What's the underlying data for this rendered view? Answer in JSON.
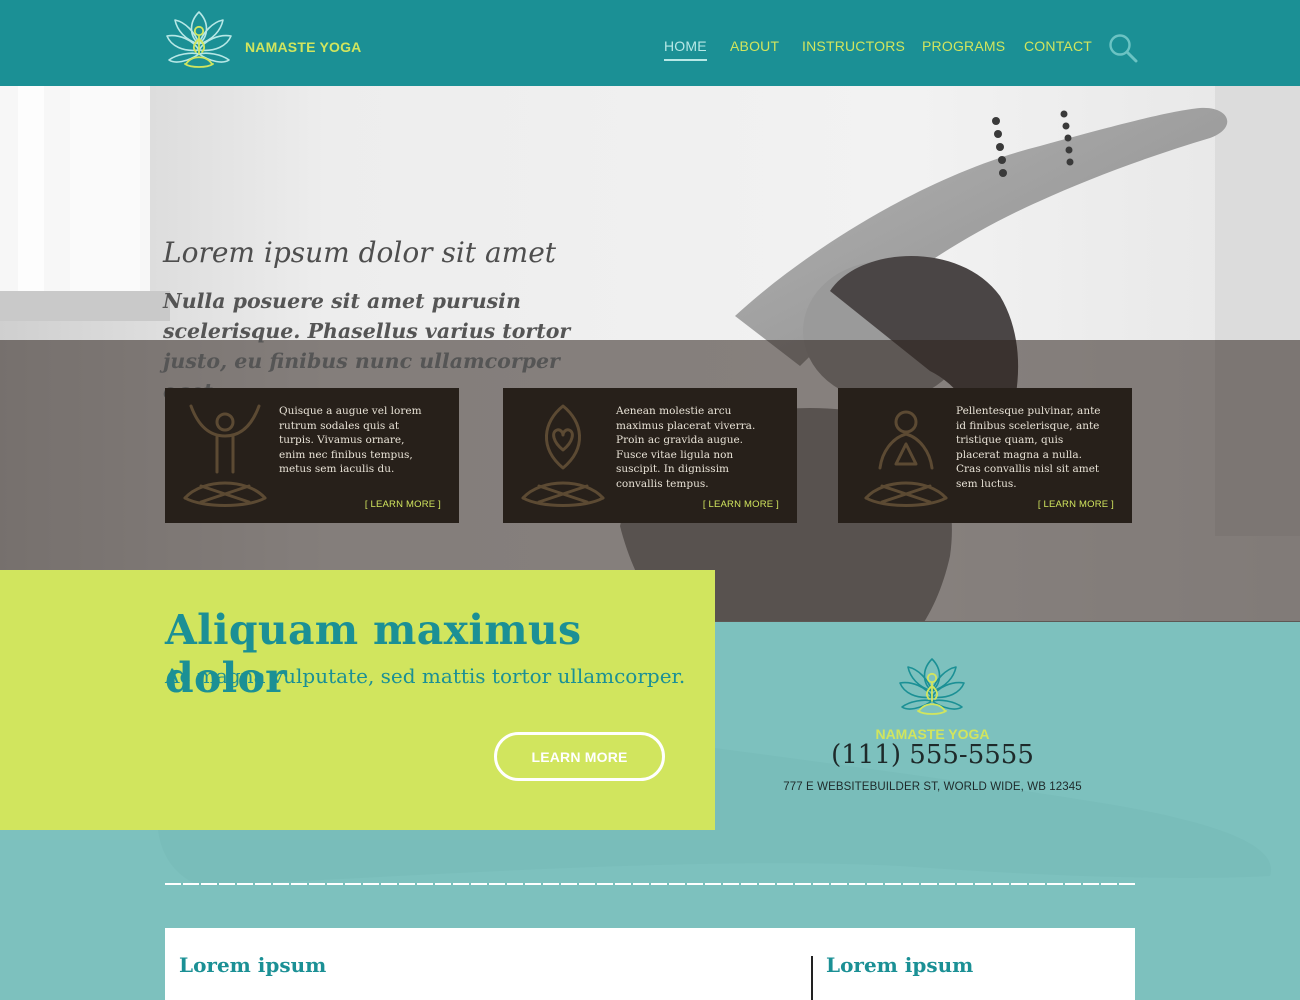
{
  "brand": {
    "name": "NAMASTE YOGA"
  },
  "nav": {
    "items": [
      {
        "label": "HOME",
        "active": true
      },
      {
        "label": "ABOUT",
        "active": false
      },
      {
        "label": "INSTRUCTORS",
        "active": false
      },
      {
        "label": "PROGRAMS",
        "active": false
      },
      {
        "label": "CONTACT",
        "active": false
      }
    ],
    "search_icon": "search-icon"
  },
  "hero": {
    "title": "Lorem ipsum dolor sit amet",
    "subtitle": "Nulla posuere sit amet purusin scelerisque. Phasellus varius tortor justo, eu finibus nunc ullamcorper eget."
  },
  "cards": [
    {
      "icon": "raised-arms-pose-icon",
      "text": "Quisque a augue vel lorem rutrum sodales quis at turpis. Vivamus ornare, enim nec finibus tempus, metus sem iaculis du.",
      "link": "[ LEARN MORE ]"
    },
    {
      "icon": "heart-lotus-pose-icon",
      "text": "Aenean molestie arcu maximus placerat viverra. Proin ac gravida augue. Fusce vitae ligula non suscipit. In dignissim convallis tempus.",
      "link": "[ LEARN MORE ]"
    },
    {
      "icon": "meditation-pose-icon",
      "text": "Pellentesque pulvinar, ante id finibus scelerisque, ante tristique quam, quis placerat magna a nulla. Cras convallis nisl sit amet sem luctus.",
      "link": "[ LEARN MORE ]"
    }
  ],
  "promo": {
    "title": "Aliquam maximus dolor",
    "subtitle": "Ac magna vulputate, sed mattis tortor ullamcorper.",
    "button": "LEARN MORE"
  },
  "contact": {
    "brand": "NAMASTE YOGA",
    "phone": "(111) 555-5555",
    "address": "777 E WEBSITEBUILDER ST, WORLD WIDE, WB 12345"
  },
  "footer_panel": {
    "left_heading": "Lorem ipsum",
    "right_heading": "Lorem ipsum"
  },
  "colors": {
    "header_teal": "#1b9095",
    "accent_lime": "#d1e55e",
    "card_dark": "#27201a",
    "overlay_teal": "#7ec8c4"
  }
}
